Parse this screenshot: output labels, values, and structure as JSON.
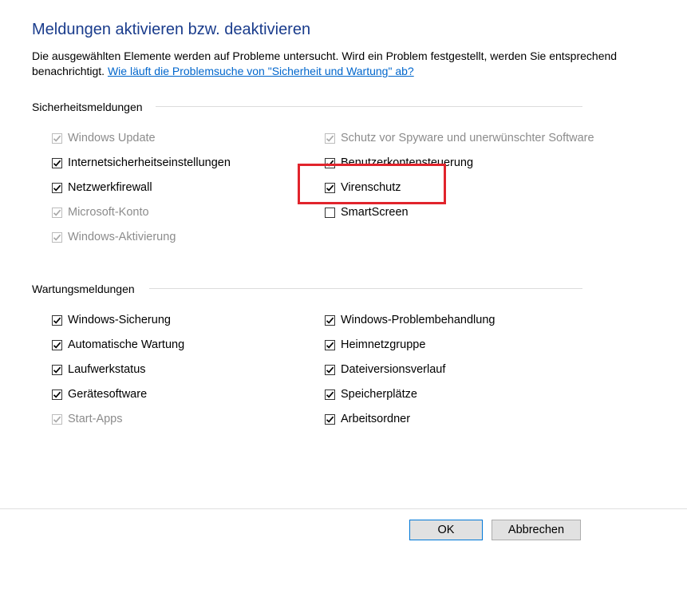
{
  "title": "Meldungen aktivieren bzw. deaktivieren",
  "description": {
    "text": "Die ausgewählten Elemente werden auf Probleme untersucht. Wird ein Problem festgestellt, werden Sie entsprechend benachrichtigt.",
    "link": "Wie läuft die Problemsuche von \"Sicherheit und Wartung\" ab?"
  },
  "security": {
    "label": "Sicherheitsmeldungen",
    "items": [
      {
        "label": "Windows Update",
        "checked": true,
        "disabled": true
      },
      {
        "label": "Schutz vor Spyware und unerwünschter Software",
        "checked": true,
        "disabled": true
      },
      {
        "label": "Internetsicherheitseinstellungen",
        "checked": true,
        "disabled": false
      },
      {
        "label": "Benutzerkontensteuerung",
        "checked": true,
        "disabled": false
      },
      {
        "label": "Netzwerkfirewall",
        "checked": true,
        "disabled": false
      },
      {
        "label": "Virenschutz",
        "checked": true,
        "disabled": false
      },
      {
        "label": "Microsoft-Konto",
        "checked": true,
        "disabled": true
      },
      {
        "label": "SmartScreen",
        "checked": false,
        "disabled": false
      },
      {
        "label": "Windows-Aktivierung",
        "checked": true,
        "disabled": true
      }
    ]
  },
  "maintenance": {
    "label": "Wartungsmeldungen",
    "items": [
      {
        "label": "Windows-Sicherung",
        "checked": true,
        "disabled": false
      },
      {
        "label": "Windows-Problembehandlung",
        "checked": true,
        "disabled": false
      },
      {
        "label": "Automatische Wartung",
        "checked": true,
        "disabled": false
      },
      {
        "label": "Heimnetzgruppe",
        "checked": true,
        "disabled": false
      },
      {
        "label": "Laufwerkstatus",
        "checked": true,
        "disabled": false
      },
      {
        "label": "Dateiversionsverlauf",
        "checked": true,
        "disabled": false
      },
      {
        "label": "Gerätesoftware",
        "checked": true,
        "disabled": false
      },
      {
        "label": "Speicherplätze",
        "checked": true,
        "disabled": false
      },
      {
        "label": "Start-Apps",
        "checked": true,
        "disabled": true
      },
      {
        "label": "Arbeitsordner",
        "checked": true,
        "disabled": false
      }
    ]
  },
  "buttons": {
    "ok": "OK",
    "cancel": "Abbrechen"
  },
  "colors": {
    "title": "#1a3c8c",
    "link": "#0066cc",
    "highlight": "#e1242c"
  }
}
